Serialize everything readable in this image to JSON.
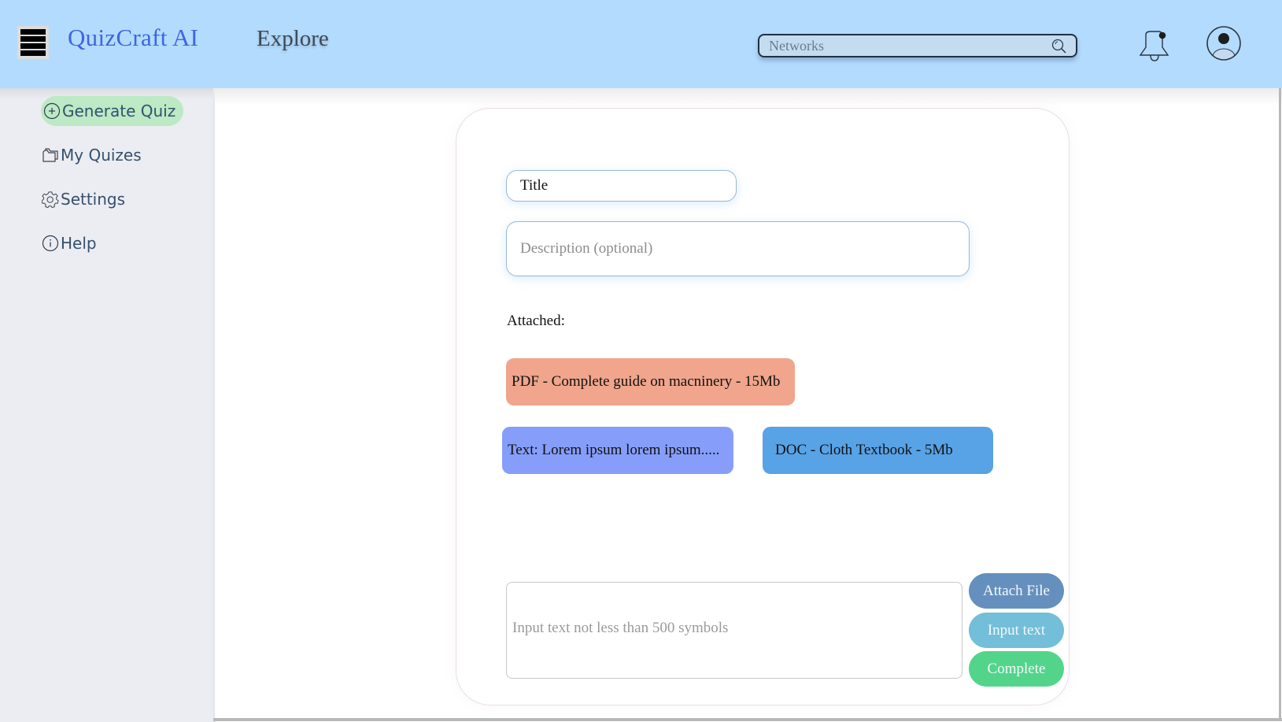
{
  "header": {
    "menu_icon": "hamburger-menu-icon",
    "app_title": "QuizCraft AI",
    "explore_label": "Explore",
    "search": {
      "value": "",
      "placeholder": "Networks",
      "icon": "search-icon"
    },
    "notification_icon": "bell-icon",
    "notification_badge": true,
    "profile_icon": "user-avatar-icon"
  },
  "sidebar": {
    "items": [
      {
        "label": "Generate Quiz",
        "icon": "plus-circle-icon",
        "active": true
      },
      {
        "label": "My Quizes",
        "icon": "folder-icon",
        "active": false
      },
      {
        "label": "Settings",
        "icon": "gear-icon",
        "active": false
      },
      {
        "label": "Help",
        "icon": "info-icon",
        "active": false
      }
    ]
  },
  "form": {
    "title": {
      "value": "Title",
      "placeholder": "Title"
    },
    "description": {
      "value": "",
      "placeholder": "Description (optional)"
    },
    "attached_label": "Attached:",
    "attachments": [
      {
        "label": "PDF - Complete guide on macninery - 15Mb",
        "type": "PDF",
        "color": "#f0a58c"
      },
      {
        "label": "Text: Lorem ipsum lorem ipsum.....",
        "type": "Text",
        "color": "#869efa"
      },
      {
        "label": "DOC - Cloth Textbook - 5Mb",
        "type": "DOC",
        "color": "#58a2e6"
      }
    ],
    "text_input": {
      "value": "",
      "placeholder": "Input text not less than 500 symbols"
    },
    "buttons": {
      "attach_file": "Attach File",
      "input_text": "Input text",
      "complete": "Complete"
    }
  },
  "colors": {
    "header_bg": "#b3dbfd",
    "brand": "#3f66de",
    "sidebar_bg": "#ecedf2",
    "active_item_bg": "#bde9c4",
    "attach_btn": "#6590bd",
    "input_btn": "#73bed8",
    "complete_btn": "#52d58a"
  }
}
